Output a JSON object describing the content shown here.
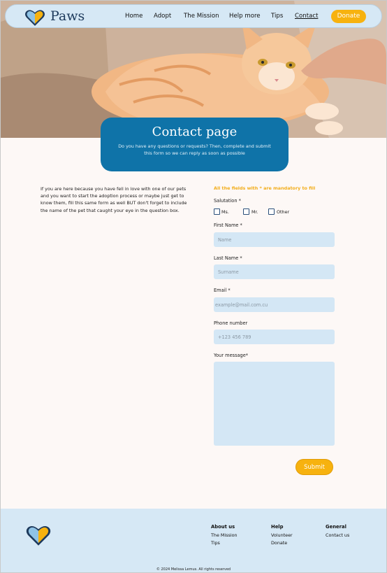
{
  "brand": {
    "name": "Paws",
    "logo": "heart-paw-logo-icon"
  },
  "nav": {
    "items": [
      {
        "label": "Home"
      },
      {
        "label": "Adopt"
      },
      {
        "label": "The Mission"
      },
      {
        "label": "Help more"
      },
      {
        "label": "Tips"
      },
      {
        "label": "Contact",
        "active": true
      }
    ],
    "donate_label": "Donate"
  },
  "hero": {
    "subject": "cat-photo"
  },
  "header_card": {
    "title": "Contact page",
    "subtitle": "Do you have any questions or requests? Then, complete and submit this form so we can reply as soon as possible"
  },
  "intro_text": "If you are here because you have fell in love with one of our pets and you want to start the adoption process or maybe just get to know them, fill this same form as well BUT don't forget to include the name of the pet that caught your eye in the question box.",
  "form": {
    "mandatory_note": "All the fields with * are mandatory to fill",
    "salutation_label": "Salutation *",
    "salutation_options": [
      "Ms.",
      "Mr.",
      "Other"
    ],
    "first_name": {
      "label": "First Name *",
      "placeholder": "Name"
    },
    "last_name": {
      "label": "Last Name *",
      "placeholder": "Surname"
    },
    "email": {
      "label": "Email *",
      "placeholder": "example@mail.com.cu"
    },
    "phone": {
      "label": "Phone number",
      "placeholder": "+123 456 789"
    },
    "message": {
      "label": "Your message*"
    },
    "submit_label": "Submit"
  },
  "footer": {
    "columns": [
      {
        "heading": "About us",
        "links": [
          "The Mission",
          "Tips"
        ]
      },
      {
        "heading": "Help",
        "links": [
          "Volunteer",
          "Donate"
        ]
      },
      {
        "heading": "General",
        "links": [
          "Contact us"
        ]
      }
    ],
    "copyright": "© 2024 Melissa Lemus. All rights reserved"
  },
  "colors": {
    "accent": "#f7b20f",
    "primary": "#0f73a8",
    "nav_bg": "#d6e8f5",
    "field_bg": "#d4e7f5"
  }
}
